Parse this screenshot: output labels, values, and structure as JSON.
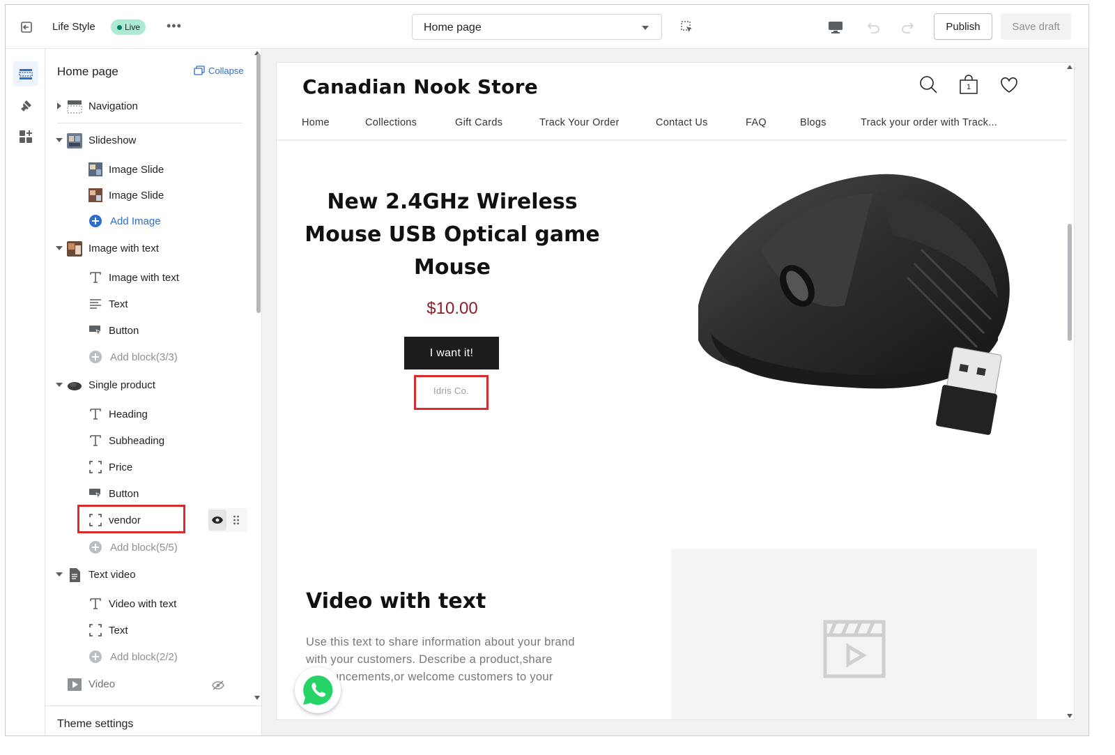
{
  "topbar": {
    "store_name": "Life Style",
    "live_badge": "Live",
    "more_label": "•••",
    "page_select": "Home page",
    "publish_label": "Publish",
    "save_draft_label": "Save draft"
  },
  "rail": {
    "items": [
      {
        "name": "sections",
        "active": true
      },
      {
        "name": "theme-settings",
        "active": false
      },
      {
        "name": "apps",
        "active": false
      }
    ]
  },
  "sidebar": {
    "title": "Home page",
    "collapse_label": "Collapse",
    "navigation": "Navigation",
    "slideshow": "Slideshow",
    "slideshow_blocks": [
      "Image Slide",
      "Image Slide"
    ],
    "add_image": "Add Image",
    "image_with_text": "Image with text",
    "iwt_blocks": [
      "Image with text",
      "Text",
      "Button"
    ],
    "iwt_add": "Add block(3/3)",
    "single_product": "Single product",
    "sp_blocks": [
      "Heading",
      "Subheading",
      "Price",
      "Button",
      "vendor"
    ],
    "sp_add": "Add block(5/5)",
    "text_video": "Text video",
    "tv_blocks": [
      "Video with text",
      "Text"
    ],
    "tv_add": "Add block(2/2)",
    "video": "Video",
    "theme_settings": "Theme settings"
  },
  "preview": {
    "store_name": "Canadian Nook Store",
    "cart_count": "1",
    "nav": [
      "Home",
      "Collections",
      "Gift Cards",
      "Track Your Order",
      "Contact Us",
      "FAQ",
      "Blogs",
      "Track your order with Track..."
    ],
    "product": {
      "title": "New 2.4GHz Wireless Mouse USB Optical game Mouse",
      "price": "$10.00",
      "button": "I want it!",
      "vendor": "Idris Co."
    },
    "video_section": {
      "title": "Video with text",
      "text": "Use this text to share information about your brand with your customers. Describe a product,share announcements,or welcome customers to your store."
    }
  },
  "colors": {
    "accent": "#2c6ecb",
    "live_badge_bg": "#aee9d1",
    "highlight": "#d82c2c",
    "price": "#8a1f2b"
  }
}
